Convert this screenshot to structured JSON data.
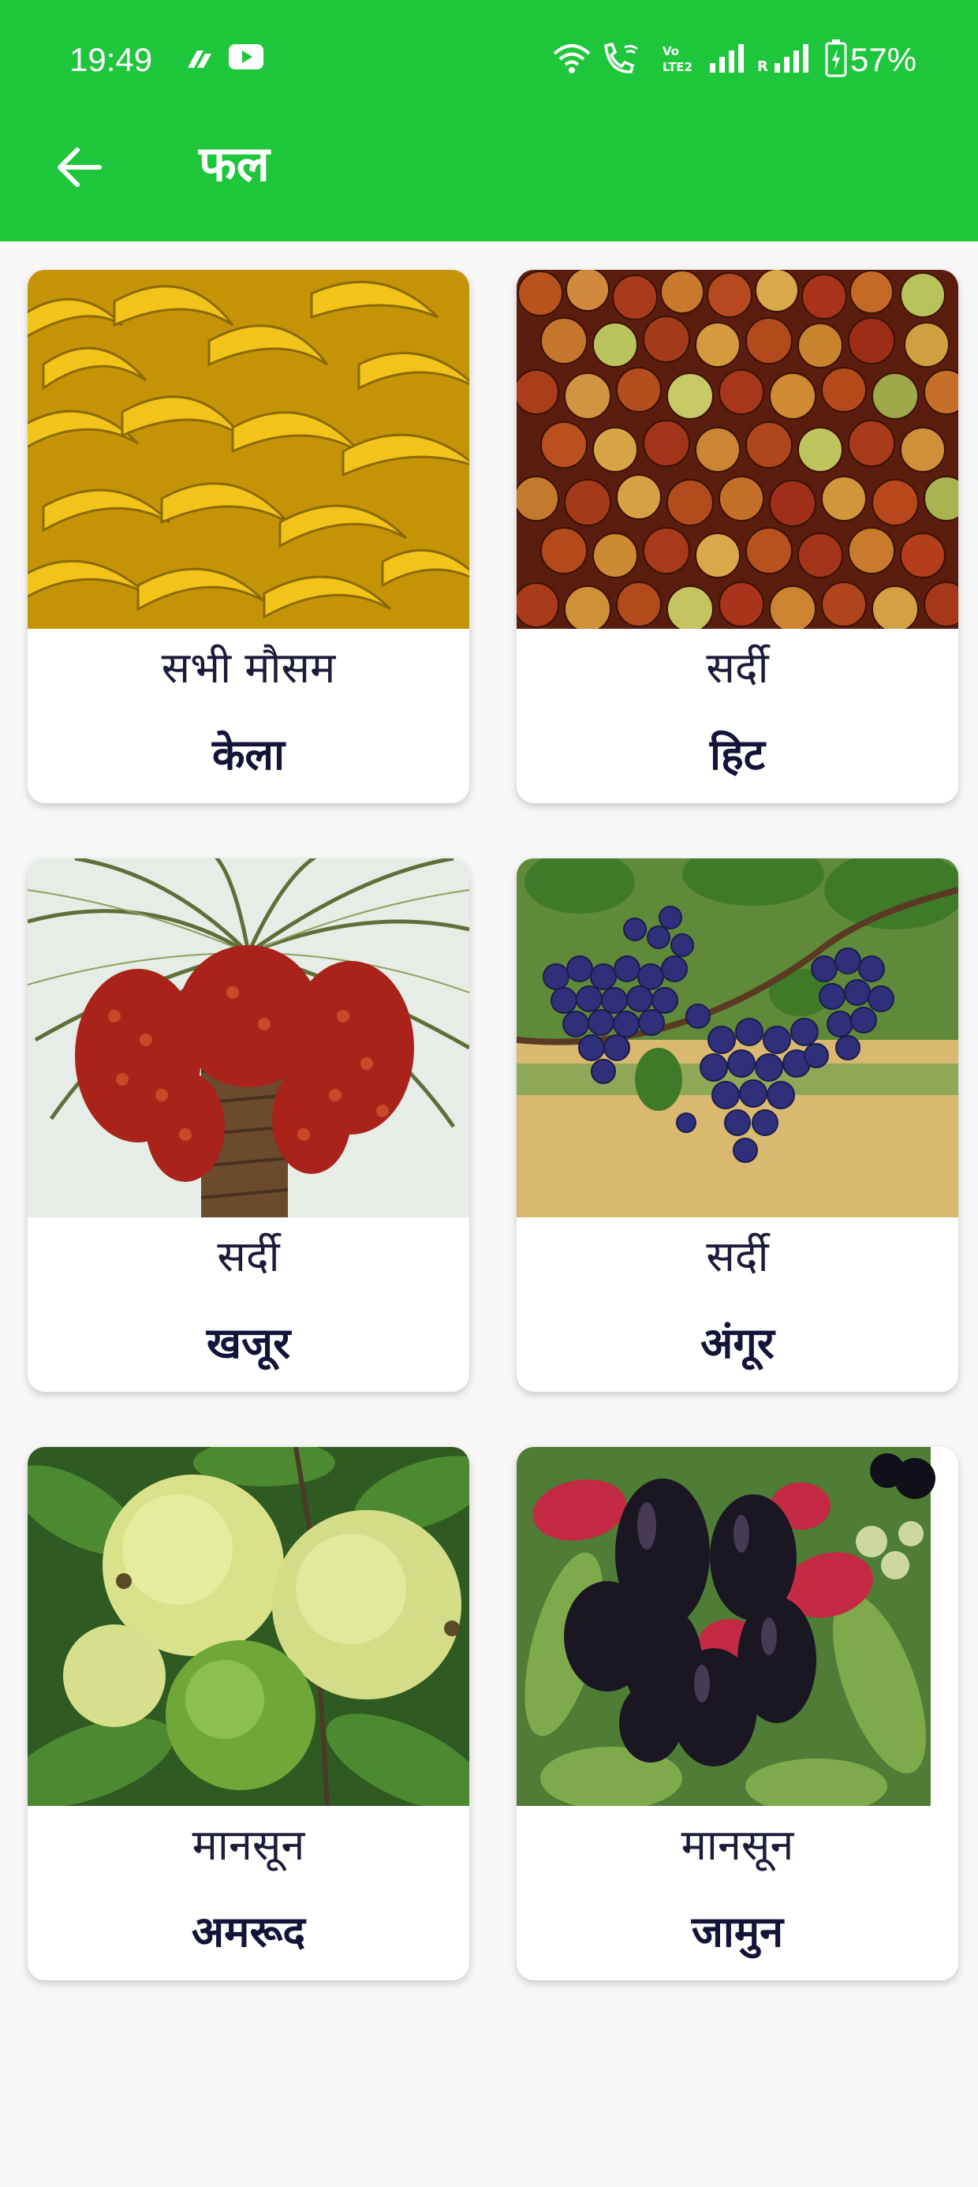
{
  "status_bar": {
    "time": "19:49",
    "battery": "57%",
    "icons": [
      "app-notification-icon",
      "youtube-icon",
      "wifi-icon",
      "wifi-calling-icon",
      "volte-icon",
      "signal-icon",
      "signal-roaming-icon",
      "battery-icon"
    ]
  },
  "toolbar": {
    "back_icon": "arrow-left-icon",
    "title": "फल",
    "color": "#1ec63c"
  },
  "fruits": [
    {
      "season": "सभी मौसम",
      "name": "केला",
      "image": "bananas"
    },
    {
      "season": "सर्दी",
      "name": "हिट",
      "image": "jujube"
    },
    {
      "season": "सर्दी",
      "name": "खजूर",
      "image": "date-palm"
    },
    {
      "season": "सर्दी",
      "name": "अंगूर",
      "image": "grapes"
    },
    {
      "season": "मानसून",
      "name": "अमरूद",
      "image": "guava"
    },
    {
      "season": "मानसून",
      "name": "जामुन",
      "image": "jamun"
    }
  ]
}
